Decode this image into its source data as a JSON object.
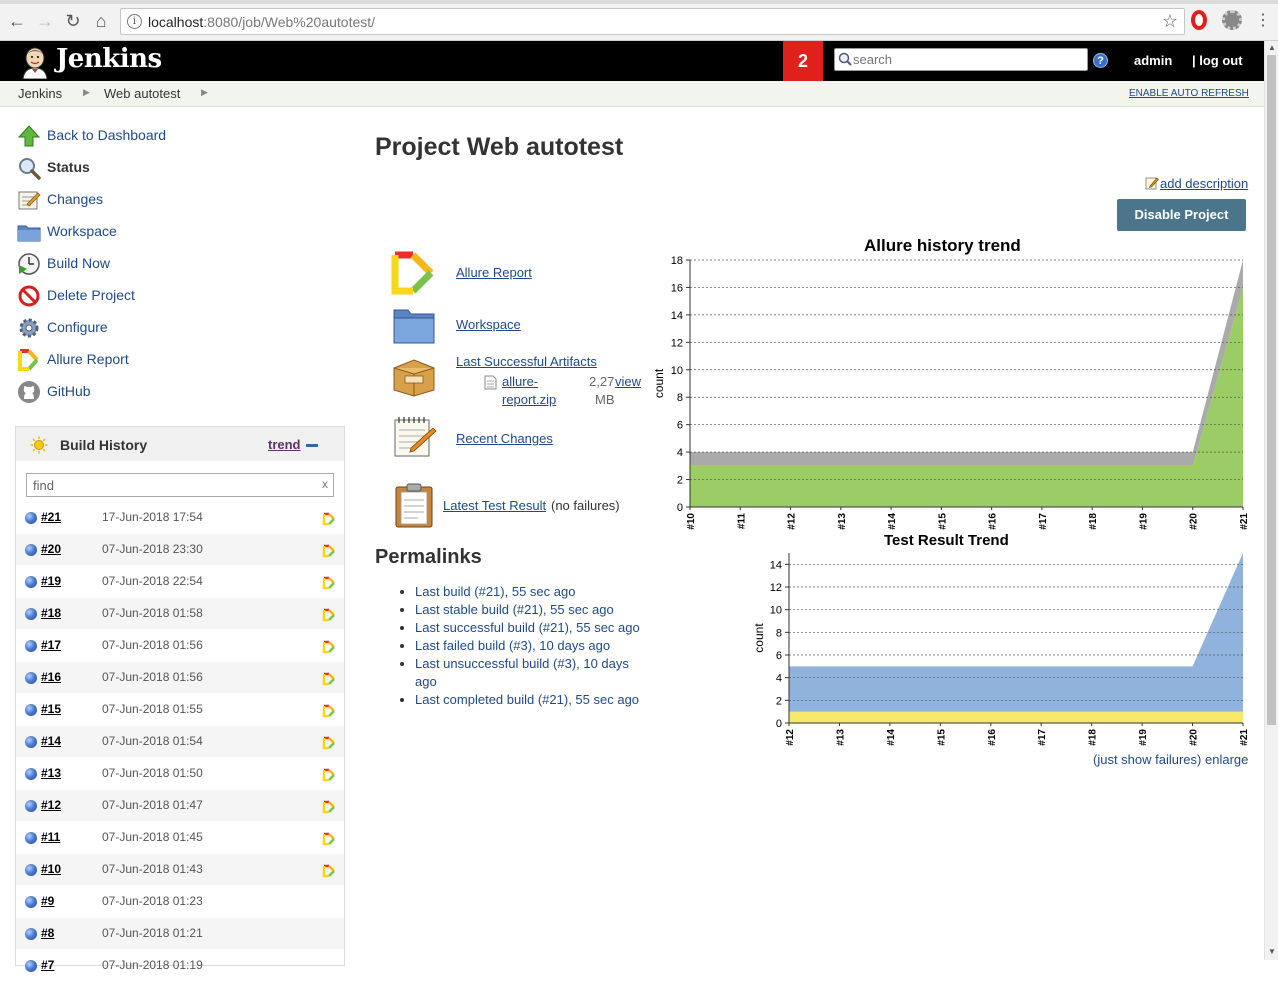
{
  "browser": {
    "url_host": "localhost",
    "url_rest": ":8080/job/Web%20autotest/"
  },
  "header": {
    "app_name": "Jenkins",
    "notification_count": "2",
    "search_placeholder": "search",
    "user": "admin",
    "logout": "log out"
  },
  "breadcrumbs": {
    "items": [
      "Jenkins",
      "Web autotest"
    ],
    "auto_refresh": "ENABLE AUTO REFRESH"
  },
  "sidebar": {
    "tasks": [
      {
        "label": "Back to Dashboard",
        "icon": "up-arrow-icon"
      },
      {
        "label": "Status",
        "icon": "magnifier-icon"
      },
      {
        "label": "Changes",
        "icon": "notepad-icon"
      },
      {
        "label": "Workspace",
        "icon": "folder-icon"
      },
      {
        "label": "Build Now",
        "icon": "clock-play-icon"
      },
      {
        "label": "Delete Project",
        "icon": "no-entry-icon"
      },
      {
        "label": "Configure",
        "icon": "gear-icon"
      },
      {
        "label": "Allure Report",
        "icon": "allure-icon"
      },
      {
        "label": "GitHub",
        "icon": "github-icon"
      }
    ]
  },
  "build_history": {
    "title": "Build History",
    "trend_label": "trend",
    "find_placeholder": "find",
    "clear_label": "x",
    "builds": [
      {
        "number": "#21",
        "date": "17-Jun-2018 17:54",
        "allure": true
      },
      {
        "number": "#20",
        "date": "07-Jun-2018 23:30",
        "allure": true
      },
      {
        "number": "#19",
        "date": "07-Jun-2018 22:54",
        "allure": true
      },
      {
        "number": "#18",
        "date": "07-Jun-2018 01:58",
        "allure": true
      },
      {
        "number": "#17",
        "date": "07-Jun-2018 01:56",
        "allure": true
      },
      {
        "number": "#16",
        "date": "07-Jun-2018 01:56",
        "allure": true
      },
      {
        "number": "#15",
        "date": "07-Jun-2018 01:55",
        "allure": true
      },
      {
        "number": "#14",
        "date": "07-Jun-2018 01:54",
        "allure": true
      },
      {
        "number": "#13",
        "date": "07-Jun-2018 01:50",
        "allure": true
      },
      {
        "number": "#12",
        "date": "07-Jun-2018 01:47",
        "allure": true
      },
      {
        "number": "#11",
        "date": "07-Jun-2018 01:45",
        "allure": true
      },
      {
        "number": "#10",
        "date": "07-Jun-2018 01:43",
        "allure": true
      },
      {
        "number": "#9",
        "date": "07-Jun-2018 01:23",
        "allure": false
      },
      {
        "number": "#8",
        "date": "07-Jun-2018 01:21",
        "allure": false
      },
      {
        "number": "#7",
        "date": "07-Jun-2018 01:19",
        "allure": false
      }
    ]
  },
  "main": {
    "title": "Project Web autotest",
    "add_description": "add description",
    "disable_button": "Disable Project",
    "links": {
      "allure_report": "Allure Report",
      "workspace": "Workspace",
      "last_artifacts": "Last Successful Artifacts",
      "artifact_name_1": "allure-",
      "artifact_name_2": "report.zip",
      "artifact_size_1": "2,27",
      "artifact_size_2": "MB",
      "artifact_view": "view",
      "recent_changes": "Recent Changes",
      "latest_test": "Latest Test Result",
      "latest_test_note": "(no failures)"
    },
    "permalinks_title": "Permalinks",
    "permalinks": [
      "Last build (#21), 55 sec ago",
      "Last stable build (#21), 55 sec ago",
      "Last successful build (#21), 55 sec ago",
      "Last failed build (#3), 10 days ago",
      "Last unsuccessful build (#3), 10 days ago",
      "Last completed build (#21), 55 sec ago"
    ],
    "trend_links": {
      "failures": "(just show failures)",
      "enlarge": "enlarge"
    }
  },
  "chart_data": [
    {
      "type": "area",
      "title": "Allure history trend",
      "ylabel": "count",
      "x": [
        "#10",
        "#11",
        "#12",
        "#13",
        "#14",
        "#15",
        "#16",
        "#17",
        "#18",
        "#19",
        "#20",
        "#21"
      ],
      "series": [
        {
          "color": "#9ccc65",
          "values": [
            3,
            3,
            3,
            3,
            3,
            3,
            3,
            3,
            3,
            3,
            3,
            16
          ]
        },
        {
          "color": "#aaaaaa",
          "values": [
            1,
            1,
            1,
            1,
            1,
            1,
            1,
            1,
            1,
            1,
            1,
            2
          ]
        }
      ],
      "ylim": [
        0,
        18
      ],
      "yticks": [
        0,
        2,
        4,
        6,
        8,
        10,
        12,
        14,
        16,
        18
      ],
      "grid": true
    },
    {
      "type": "area",
      "title": "Test Result Trend",
      "ylabel": "count",
      "x": [
        "#12",
        "#13",
        "#14",
        "#15",
        "#16",
        "#17",
        "#18",
        "#19",
        "#20",
        "#21"
      ],
      "series": [
        {
          "color": "#f5e86b",
          "values": [
            1,
            1,
            1,
            1,
            1,
            1,
            1,
            1,
            1,
            1
          ]
        },
        {
          "color": "#8fb3dd",
          "values": [
            4,
            4,
            4,
            4,
            4,
            4,
            4,
            4,
            4,
            14
          ]
        }
      ],
      "ylim": [
        0,
        15
      ],
      "yticks": [
        0,
        2,
        4,
        6,
        8,
        10,
        12,
        14
      ],
      "grid": true
    }
  ]
}
